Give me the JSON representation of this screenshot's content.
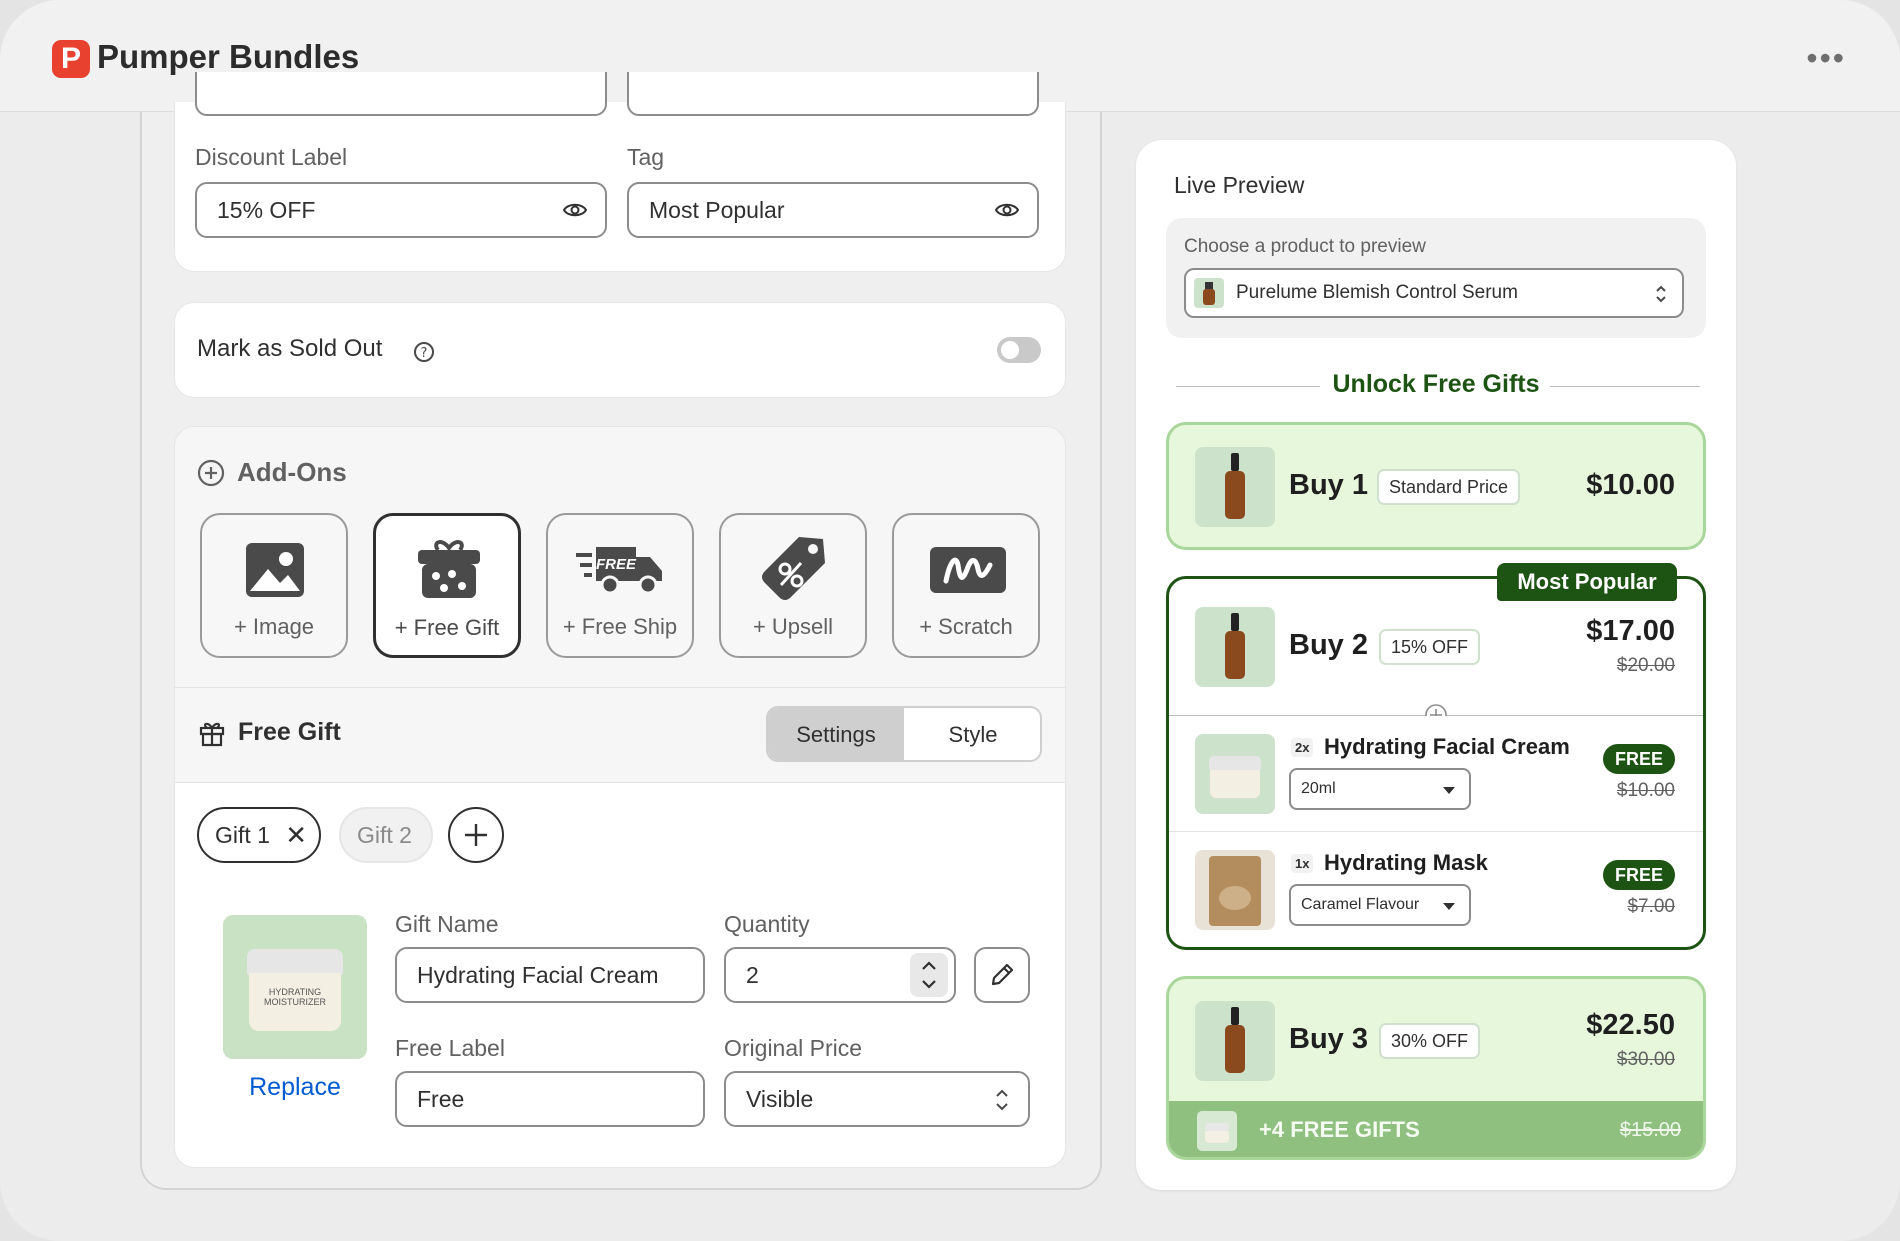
{
  "app": {
    "title": "Pumper Bundles",
    "logo_letter": "P",
    "more": "•••"
  },
  "form": {
    "discount_label": {
      "label": "Discount Label",
      "value": "15% OFF"
    },
    "tag": {
      "label": "Tag",
      "value": "Most Popular"
    },
    "sold_out": {
      "label": "Mark as Sold Out"
    }
  },
  "addons": {
    "title": "Add-Ons",
    "items": [
      {
        "label": "+ Image"
      },
      {
        "label": "+ Free Gift"
      },
      {
        "label": "+ Free Ship"
      },
      {
        "label": "+ Upsell"
      },
      {
        "label": "+ Scratch"
      }
    ],
    "free_ship_icon_text": "FREE"
  },
  "free_gift": {
    "title": "Free Gift",
    "tabs": [
      "Settings",
      "Style"
    ],
    "gifts": [
      "Gift 1",
      "Gift 2"
    ],
    "replace": "Replace",
    "image_text": "HYDRATING MOISTURIZER",
    "gift_name": {
      "label": "Gift Name",
      "value": "Hydrating Facial Cream"
    },
    "quantity": {
      "label": "Quantity",
      "value": "2"
    },
    "free_label": {
      "label": "Free Label",
      "value": "Free"
    },
    "original_price": {
      "label": "Original Price",
      "value": "Visible"
    }
  },
  "preview": {
    "title": "Live Preview",
    "chooser_label": "Choose a product to preview",
    "product": "Purelume Blemish Control Serum",
    "heading": "Unlock Free Gifts",
    "tier1": {
      "title": "Buy 1",
      "badge": "Standard Price",
      "price": "$10.00"
    },
    "tier2": {
      "tag": "Most Popular",
      "title": "Buy 2",
      "badge": "15% OFF",
      "price": "$17.00",
      "old": "$20.00",
      "gifts": [
        {
          "qty": "2x",
          "name": "Hydrating Facial Cream",
          "variant": "20ml",
          "free": "FREE",
          "old": "$10.00"
        },
        {
          "qty": "1x",
          "name": "Hydrating Mask",
          "variant": "Caramel Flavour",
          "free": "FREE",
          "old": "$7.00"
        }
      ]
    },
    "tier3": {
      "title": "Buy 3",
      "badge": "30% OFF",
      "price": "$22.50",
      "old": "$30.00",
      "gifts_label": "+4 FREE GIFTS",
      "gifts_old": "$15.00"
    }
  },
  "colors": {
    "accent_green": "#1d5313",
    "light_green": "#e6f7dc",
    "mid_green": "#8fc080",
    "link_blue": "#005bd3"
  }
}
